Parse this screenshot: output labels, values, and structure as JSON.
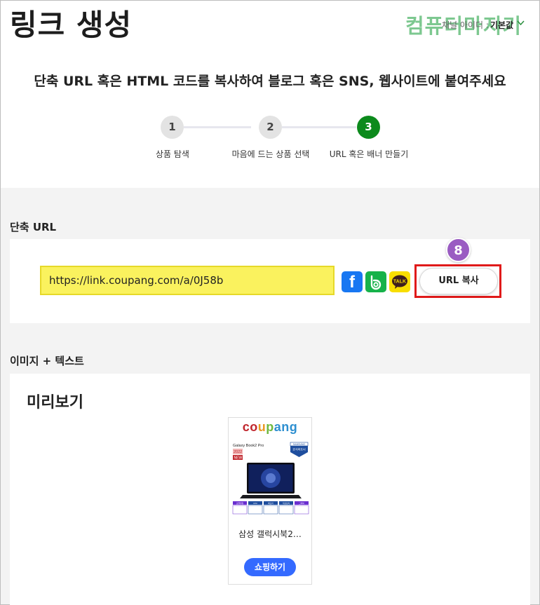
{
  "page": {
    "title": "링크 생성",
    "channel_label": "채널 아이디 :",
    "channel_value": "기본값",
    "watermark": "컴퓨터마지기"
  },
  "header": {
    "heading": "단축 URL 혹은 HTML 코드를 복사하여 블로그 혹은 SNS, 웹사이트에 붙여주세요"
  },
  "steps": [
    {
      "number": "1",
      "label": "상품 탐색",
      "active": false
    },
    {
      "number": "2",
      "label": "마음에 드는 상품 선택",
      "active": false
    },
    {
      "number": "3",
      "label": "URL 혹은 배너 만들기",
      "active": true
    }
  ],
  "short_url": {
    "section_label": "단축 URL",
    "url": "https://link.coupang.com/a/0J58b",
    "copy_button": "URL 복사",
    "step_badge": "8",
    "share_icons": [
      "facebook-icon",
      "band-icon",
      "kakaotalk-icon"
    ],
    "kakao_text": "TALK"
  },
  "image_text": {
    "section_label": "이미지 + 텍스트",
    "preview_title": "미리보기",
    "product": {
      "logo": "coupang",
      "banner_model": "Galaxy Book2 Pro",
      "banner_year": "2022",
      "banner_new": "NEW",
      "banner_brand": "SAMSUNG",
      "banner_badge": "공식파트너",
      "banner_specs": [
        "모델명칭",
        "CPU",
        "메모리",
        "저장장치",
        "그래픽"
      ],
      "name": "삼성 갤럭시북2…",
      "shop_button": "쇼핑하기"
    }
  },
  "colors": {
    "active_step": "#0c8a1c",
    "url_highlight": "#faf25e",
    "highlight_border": "#e01a1a",
    "badge": "#9a5cc2",
    "shop_button": "#346aff"
  }
}
